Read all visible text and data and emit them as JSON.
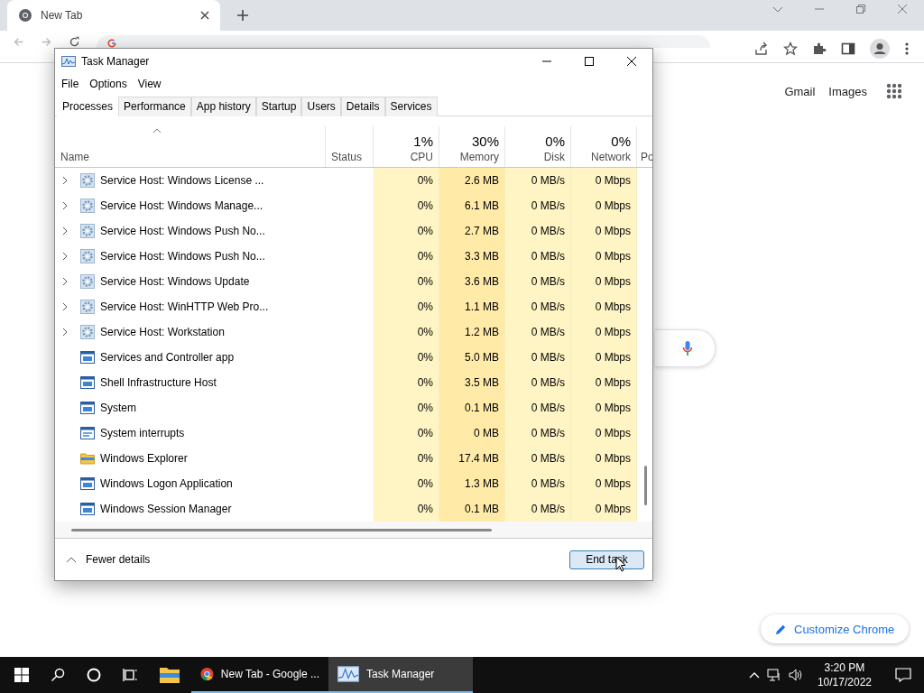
{
  "browser": {
    "tab_title": "New Tab",
    "links": [
      "Gmail",
      "Images"
    ],
    "customize_button": "Customize Chrome"
  },
  "task_manager": {
    "title": "Task Manager",
    "menu": [
      "File",
      "Options",
      "View"
    ],
    "tabs": [
      {
        "label": "Processes",
        "selected": true
      },
      {
        "label": "Performance",
        "selected": false
      },
      {
        "label": "App history",
        "selected": false
      },
      {
        "label": "Startup",
        "selected": false
      },
      {
        "label": "Users",
        "selected": false
      },
      {
        "label": "Details",
        "selected": false
      },
      {
        "label": "Services",
        "selected": false
      }
    ],
    "columns": [
      {
        "label": "Name",
        "kind": "name"
      },
      {
        "label": "Status",
        "kind": "text"
      },
      {
        "label": "CPU",
        "percent": "1%",
        "kind": "metric"
      },
      {
        "label": "Memory",
        "percent": "30%",
        "kind": "metric"
      },
      {
        "label": "Disk",
        "percent": "0%",
        "kind": "metric"
      },
      {
        "label": "Network",
        "percent": "0%",
        "kind": "metric"
      },
      {
        "label": "Po",
        "kind": "cut"
      }
    ],
    "rows": [
      {
        "name": "Service Host: Windows License ...",
        "kind": "service",
        "expandable": true,
        "cpu": "0%",
        "memory": "2.6 MB",
        "disk": "0 MB/s",
        "network": "0 Mbps"
      },
      {
        "name": "Service Host: Windows Manage...",
        "kind": "service",
        "expandable": true,
        "cpu": "0%",
        "memory": "6.1 MB",
        "disk": "0 MB/s",
        "network": "0 Mbps"
      },
      {
        "name": "Service Host: Windows Push No...",
        "kind": "service",
        "expandable": true,
        "cpu": "0%",
        "memory": "2.7 MB",
        "disk": "0 MB/s",
        "network": "0 Mbps"
      },
      {
        "name": "Service Host: Windows Push No...",
        "kind": "service",
        "expandable": true,
        "cpu": "0%",
        "memory": "3.3 MB",
        "disk": "0 MB/s",
        "network": "0 Mbps"
      },
      {
        "name": "Service Host: Windows Update",
        "kind": "service",
        "expandable": true,
        "cpu": "0%",
        "memory": "3.6 MB",
        "disk": "0 MB/s",
        "network": "0 Mbps"
      },
      {
        "name": "Service Host: WinHTTP Web Pro...",
        "kind": "service",
        "expandable": true,
        "cpu": "0%",
        "memory": "1.1 MB",
        "disk": "0 MB/s",
        "network": "0 Mbps"
      },
      {
        "name": "Service Host: Workstation",
        "kind": "service",
        "expandable": true,
        "cpu": "0%",
        "memory": "1.2 MB",
        "disk": "0 MB/s",
        "network": "0 Mbps"
      },
      {
        "name": "Services and Controller app",
        "kind": "app",
        "expandable": false,
        "cpu": "0%",
        "memory": "5.0 MB",
        "disk": "0 MB/s",
        "network": "0 Mbps"
      },
      {
        "name": "Shell Infrastructure Host",
        "kind": "app",
        "expandable": false,
        "cpu": "0%",
        "memory": "3.5 MB",
        "disk": "0 MB/s",
        "network": "0 Mbps"
      },
      {
        "name": "System",
        "kind": "app",
        "expandable": false,
        "cpu": "0%",
        "memory": "0.1 MB",
        "disk": "0 MB/s",
        "network": "0 Mbps"
      },
      {
        "name": "System interrupts",
        "kind": "list",
        "expandable": false,
        "cpu": "0%",
        "memory": "0 MB",
        "disk": "0 MB/s",
        "network": "0 Mbps"
      },
      {
        "name": "Windows Explorer",
        "kind": "folder",
        "expandable": false,
        "cpu": "0%",
        "memory": "17.4 MB",
        "disk": "0 MB/s",
        "network": "0 Mbps"
      },
      {
        "name": "Windows Logon Application",
        "kind": "app",
        "expandable": false,
        "cpu": "0%",
        "memory": "1.3 MB",
        "disk": "0 MB/s",
        "network": "0 Mbps"
      },
      {
        "name": "Windows Session Manager",
        "kind": "app",
        "expandable": false,
        "cpu": "0%",
        "memory": "0.1 MB",
        "disk": "0 MB/s",
        "network": "0 Mbps"
      }
    ],
    "footer": {
      "toggle": "Fewer details",
      "button": "End task"
    }
  },
  "taskbar": {
    "apps": [
      {
        "kind": "explorer",
        "selected": false
      },
      {
        "kind": "chrome",
        "label": "New Tab - Google ...",
        "selected": false
      },
      {
        "kind": "taskmgr",
        "label": "Task Manager",
        "selected": true
      }
    ],
    "time": "3:20 PM",
    "date": "10/17/2022"
  }
}
